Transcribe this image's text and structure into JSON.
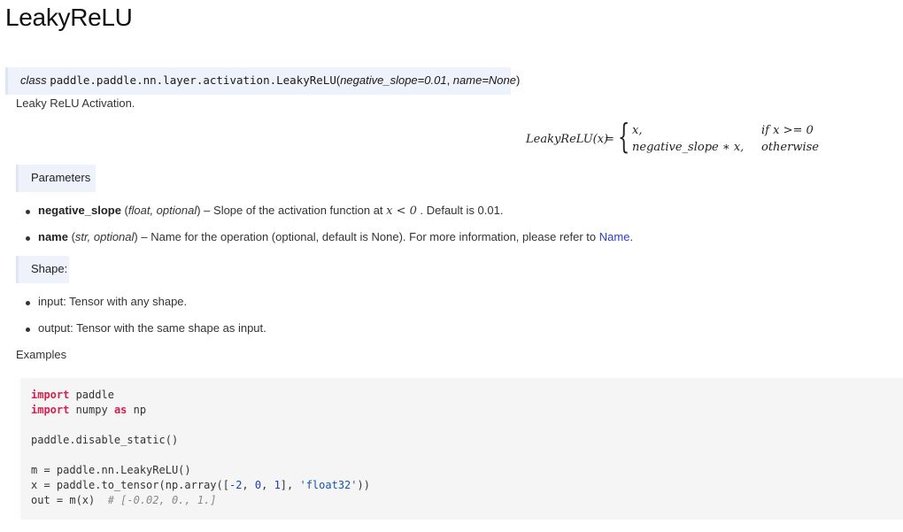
{
  "page": {
    "title": "LeakyReLU"
  },
  "signature": {
    "prefix": "class",
    "path": "paddle.paddle.nn.layer.activation.LeakyReLU",
    "open": "(",
    "param1": "negative_slope=0.01",
    "sep": ", ",
    "param2": "name=None",
    "close": ")"
  },
  "description": "Leaky ReLU Activation.",
  "formula": {
    "lhs": "LeakyReLU(x)",
    "eq": "=",
    "case1": "x,",
    "case2": "negative_slope ∗ x,",
    "cond1": "if x >= 0",
    "cond2": "otherwise"
  },
  "parameters": {
    "heading": "Parameters",
    "items": [
      {
        "name": "negative_slope",
        "type_open": " (",
        "type": "float, optional",
        "type_close": ") – Slope of the activation function at ",
        "math": "x < 0",
        "tail": " . Default is 0.01."
      },
      {
        "name": "name",
        "type_open": " (",
        "type": "str, optional",
        "type_close": ") – Name for the operation (optional, default is None). For more information, please refer to ",
        "link": "Name",
        "tail": "."
      }
    ]
  },
  "shape": {
    "heading": "Shape:",
    "items": [
      "input: Tensor with any shape.",
      "output: Tensor with the same shape as input."
    ]
  },
  "examples_label": "Examples",
  "code": {
    "l1_kw": "import",
    "l1_rest": " paddle",
    "l2_kw": "import",
    "l2_mid": " numpy ",
    "l2_kw2": "as",
    "l2_rest": " np",
    "l4": "paddle.disable_static()",
    "l6": "m = paddle.nn.LeakyReLU()",
    "l7_a": "x = paddle.to_tensor(np.array([",
    "l7_n1": "-2",
    "l7_c1": ", ",
    "l7_n2": "0",
    "l7_c2": ", ",
    "l7_n3": "1",
    "l7_b": "], ",
    "l7_s": "'float32'",
    "l7_end": "))",
    "l8_a": "out = m(x)  ",
    "l8_cm": "# [-0.02, 0., 1.]"
  }
}
